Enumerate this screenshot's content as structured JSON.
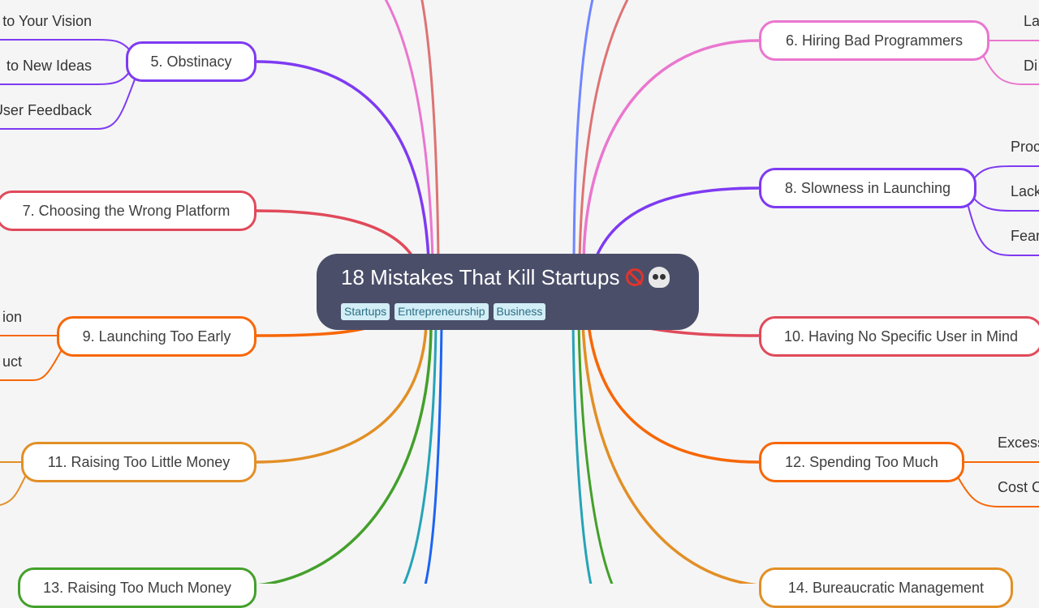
{
  "root": {
    "title": "18 Mistakes That Kill Startups",
    "emoji_icons": [
      "no-entry-icon",
      "skull-icon"
    ],
    "tags": [
      "Startups",
      "Entrepreneurship",
      "Business"
    ]
  },
  "branches": [
    {
      "id": "b5",
      "label": "5. Obstinacy",
      "color": "#7e3af2",
      "side": "left",
      "children": [
        "to Your Vision",
        "to New Ideas",
        "User Feedback"
      ]
    },
    {
      "id": "b7",
      "label": "7. Choosing the Wrong Platform",
      "color": "#e04a5a",
      "side": "left",
      "children": []
    },
    {
      "id": "b9",
      "label": "9. Launching Too Early",
      "color": "#f76707",
      "side": "left",
      "children": [
        "ion",
        "uct"
      ]
    },
    {
      "id": "b11",
      "label": "11. Raising Too Little Money",
      "color": "#e28f26",
      "side": "left",
      "children": []
    },
    {
      "id": "b13",
      "label": "13. Raising Too Much Money",
      "color": "#43a02b",
      "side": "left",
      "children": []
    },
    {
      "id": "b6",
      "label": "6. Hiring Bad Programmers",
      "color": "#ea76cf",
      "side": "right",
      "children": [
        "La",
        "Di"
      ]
    },
    {
      "id": "b8",
      "label": "8. Slowness in Launching",
      "color": "#7e3af2",
      "side": "right",
      "children": [
        "Proc",
        "Lack",
        "Fear"
      ]
    },
    {
      "id": "b10",
      "label": "10. Having No Specific User in Mind",
      "color": "#e04a5a",
      "side": "right",
      "children": []
    },
    {
      "id": "b12",
      "label": "12. Spending Too Much",
      "color": "#f76707",
      "side": "right",
      "children": [
        "Excess",
        "Cost C"
      ]
    },
    {
      "id": "b14",
      "label": "14. Bureaucratic Management",
      "color": "#e28f26",
      "side": "right",
      "children": []
    }
  ],
  "offscreen_edge_colors": {
    "top_left": [
      "#ea76cf",
      "#dd7374"
    ],
    "top_right": [
      "#6f86ff",
      "#dd7374"
    ],
    "bottom_left": [
      "#25a3b8",
      "#1c64f2"
    ],
    "bottom_right": [
      "#25a3b8",
      "#43a02b"
    ]
  }
}
